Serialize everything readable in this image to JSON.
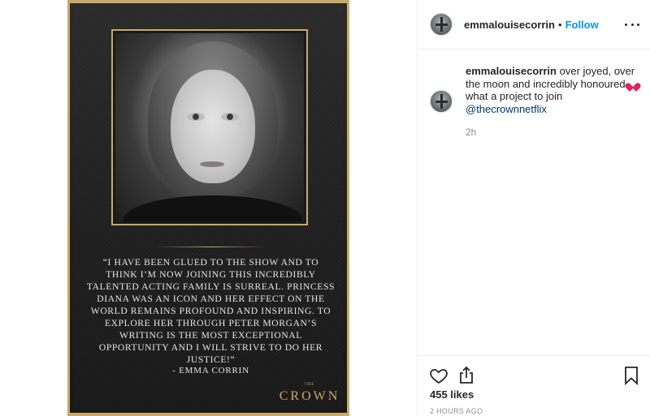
{
  "poster": {
    "quote": "“I have been glued to the show and to think I’m now joining this incredibly talented acting family is surreal. Princess Diana was an icon and her effect on the world remains profound and inspiring. To explore her through Peter Morgan’s writing is the most exceptional opportunity and I will strive to do her justice!”",
    "attribution": "- EMMA CORRIN",
    "wordmark_small": "THE",
    "wordmark": "CROWN"
  },
  "header": {
    "username": "emmalouisecorrin",
    "separator": "•",
    "follow_label": "Follow",
    "more_icon": "more-options-icon"
  },
  "caption": {
    "username": "emmalouisecorrin",
    "text_1": " over joyed, over the moon and incredibly honoured ",
    "text_2": " what a project to join ",
    "mention": "@thecrownnetflix",
    "time": "2h"
  },
  "actions": {
    "like_icon": "heart-outline-icon",
    "share_icon": "share-upload-icon",
    "save_icon": "bookmark-icon",
    "likes": "455 likes",
    "timestamp": "2 HOURS AGO"
  },
  "colors": {
    "accent_link": "#0095f6",
    "mention": "#00376b",
    "gold": "#c9a86b"
  }
}
